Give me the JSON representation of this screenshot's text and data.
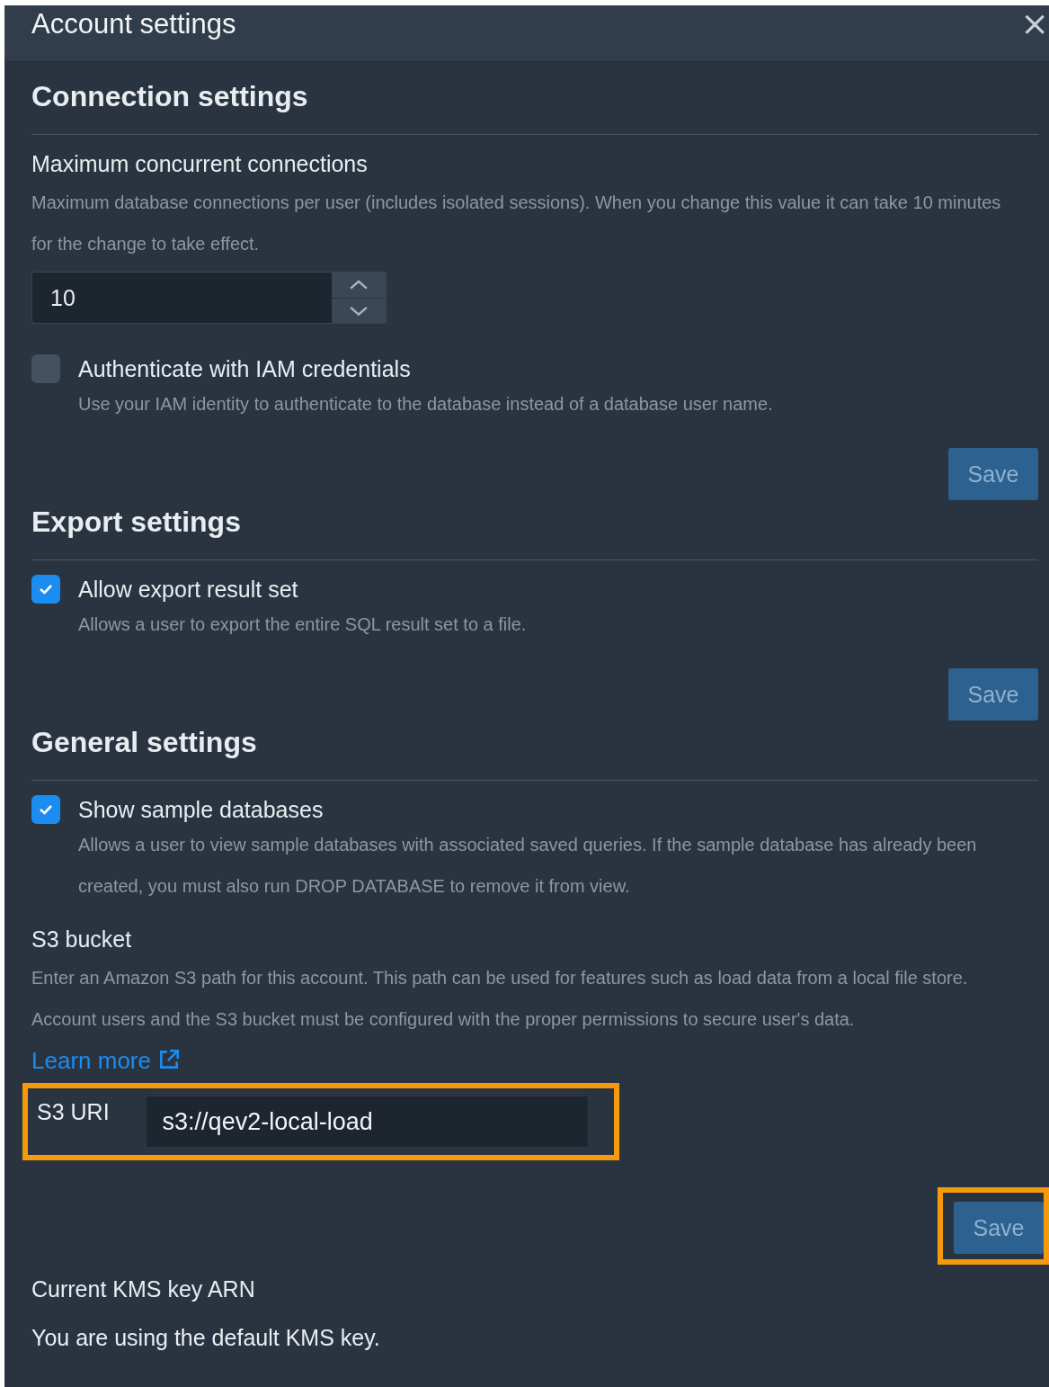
{
  "window": {
    "title": "Account settings",
    "close": "×"
  },
  "sections": [
    {
      "title": "Connection settings",
      "fields": [
        {
          "kind": "number",
          "label": "Maximum concurrent connections",
          "description": "Maximum database connections per user (includes isolated sessions). When you change this value it can take 10 minutes for the change to take effect.",
          "value": "10"
        },
        {
          "kind": "checkbox",
          "label": "Authenticate with IAM credentials",
          "description": "Use your IAM identity to authenticate to the database instead of a database user name.",
          "checked": false
        }
      ],
      "save": {
        "label": "Save",
        "highlighted": false
      }
    },
    {
      "title": "Export settings",
      "fields": [
        {
          "kind": "checkbox",
          "label": "Allow export result set",
          "description": "Allows a user to export the entire SQL result set to a file.",
          "checked": true
        }
      ],
      "save": {
        "label": "Save",
        "highlighted": false
      }
    },
    {
      "title": "General settings",
      "fields": [
        {
          "kind": "checkbox",
          "label": "Show sample databases",
          "description": "Allows a user to view sample databases with associated saved queries. If the sample database has already been created, you must also run DROP DATABASE to remove it from view.",
          "checked": true
        },
        {
          "kind": "uri",
          "label": "S3 bucket",
          "description": "Enter an Amazon S3 path for this account. This path can be used for features such as load data from a local file store. Account users and the S3 bucket must be configured with the proper permissions to secure user's data.",
          "link": "Learn more",
          "field_label": "S3 URI",
          "value": "s3://qev2-local-load",
          "highlighted": true
        }
      ],
      "save": {
        "label": "Save",
        "highlighted": true
      },
      "after": [
        "Current KMS key ARN",
        "You are using the default KMS key."
      ]
    }
  ]
}
